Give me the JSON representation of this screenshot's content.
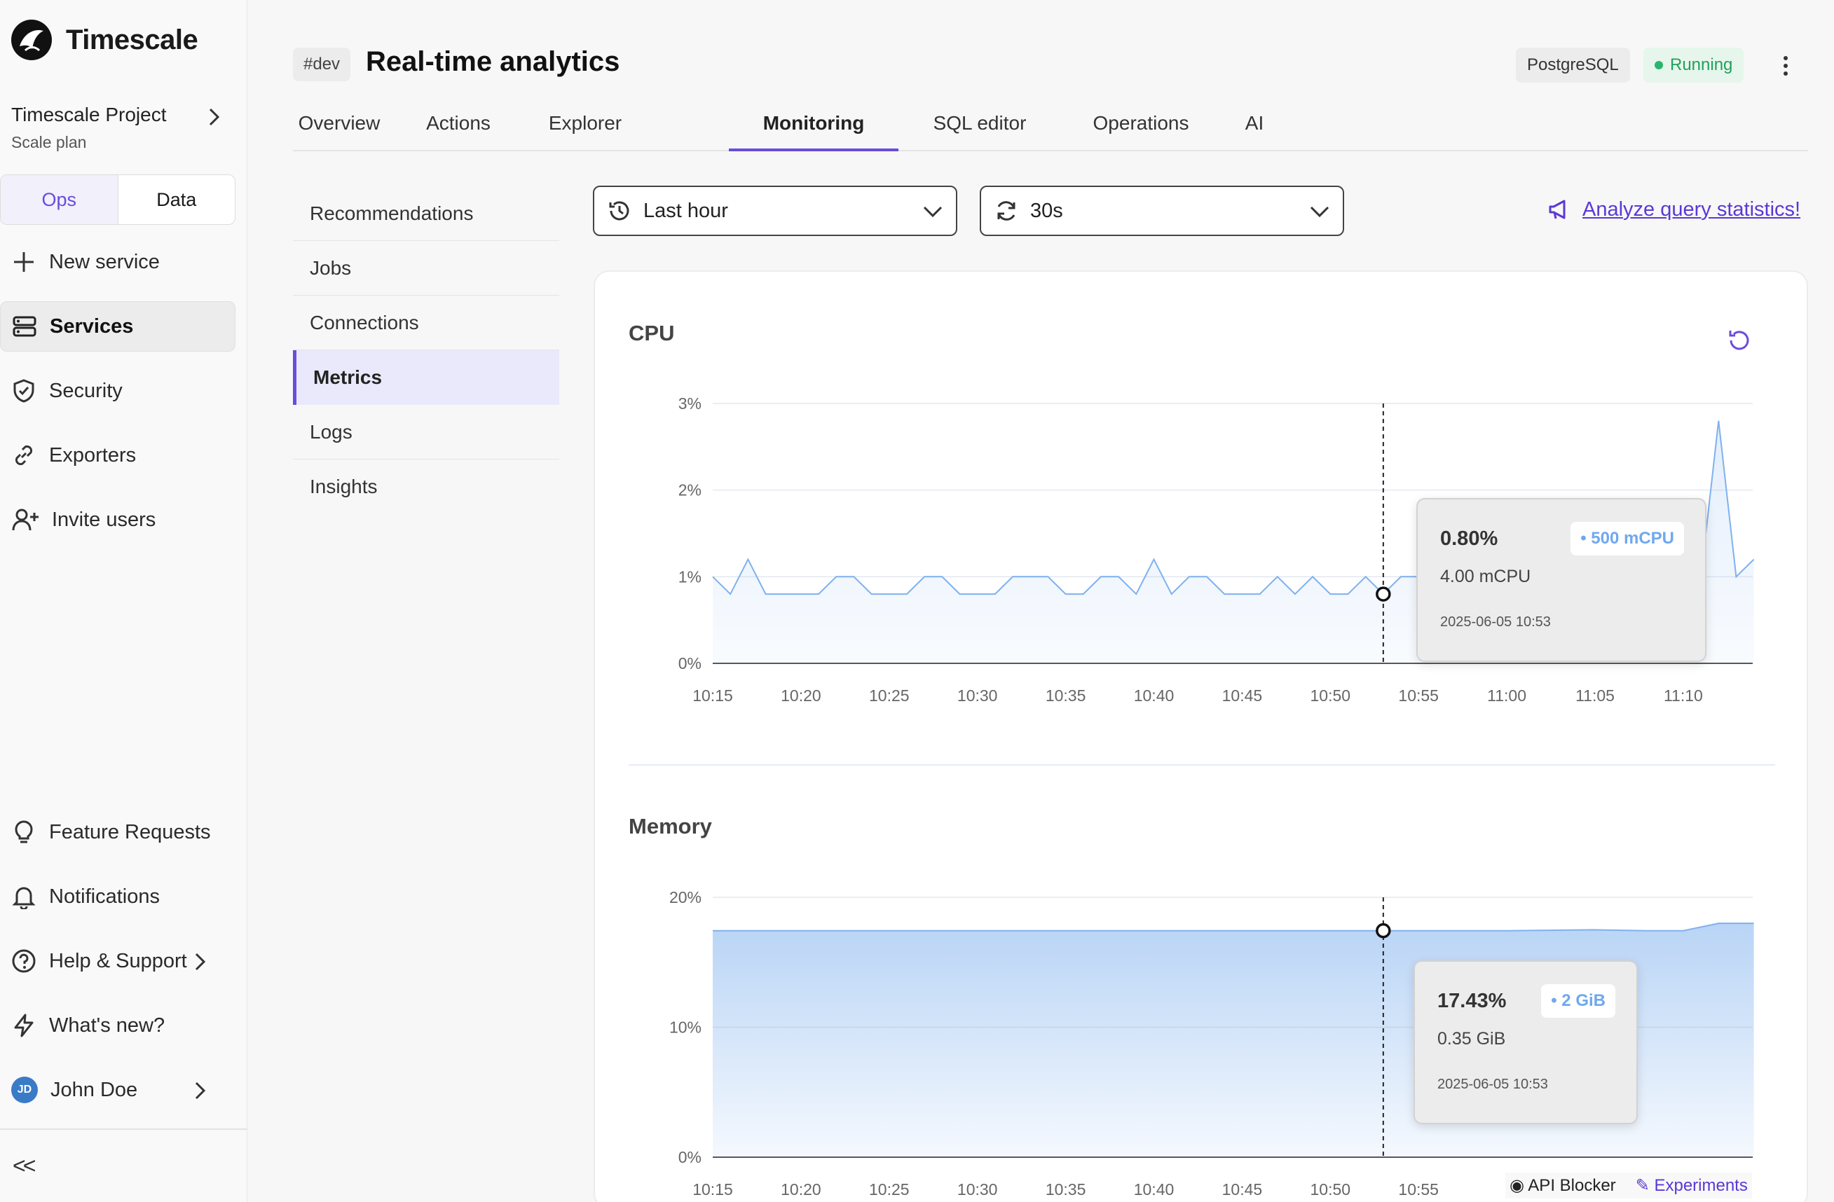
{
  "app": {
    "name": "Timescale"
  },
  "sidebar": {
    "project_name": "Timescale Project",
    "project_plan": "Scale plan",
    "toggle": {
      "ops": "Ops",
      "data": "Data"
    },
    "items": [
      {
        "label": "New service",
        "icon": "plus-icon"
      },
      {
        "label": "Services",
        "icon": "server-icon",
        "active": true
      },
      {
        "label": "Security",
        "icon": "shield-icon"
      },
      {
        "label": "Exporters",
        "icon": "link-icon"
      },
      {
        "label": "Invite users",
        "icon": "user-plus-icon"
      }
    ],
    "bottom_items": [
      {
        "label": "Feature Requests",
        "icon": "lightbulb-icon"
      },
      {
        "label": "Notifications",
        "icon": "bell-icon"
      },
      {
        "label": "Help & Support",
        "icon": "help-icon"
      },
      {
        "label": "What's new?",
        "icon": "lightning-icon"
      }
    ],
    "user": {
      "name": "John Doe",
      "initials": "JD"
    },
    "collapse_label": "<<"
  },
  "header": {
    "env_badge": "#dev",
    "title": "Real-time analytics",
    "db_badge": "PostgreSQL",
    "status": "Running",
    "status_color": "#22a05a"
  },
  "tabs": [
    "Overview",
    "Actions",
    "Explorer",
    "Monitoring",
    "SQL editor",
    "Operations",
    "AI"
  ],
  "active_tab": "Monitoring",
  "subnav": [
    "Recommendations",
    "Jobs",
    "Connections",
    "Metrics",
    "Logs",
    "Insights"
  ],
  "active_subnav": "Metrics",
  "filters": {
    "time_range": "Last hour",
    "refresh_interval": "30s",
    "analyze_link": "Analyze query statistics!"
  },
  "accent_color": "#6a4bdb",
  "chart_data": [
    {
      "type": "area",
      "title": "CPU",
      "x": [
        "10:15",
        "10:16",
        "10:17",
        "10:18",
        "10:19",
        "10:20",
        "10:21",
        "10:22",
        "10:23",
        "10:24",
        "10:25",
        "10:26",
        "10:27",
        "10:28",
        "10:29",
        "10:30",
        "10:31",
        "10:32",
        "10:33",
        "10:34",
        "10:35",
        "10:36",
        "10:37",
        "10:38",
        "10:39",
        "10:40",
        "10:41",
        "10:42",
        "10:43",
        "10:44",
        "10:45",
        "10:46",
        "10:47",
        "10:48",
        "10:49",
        "10:50",
        "10:51",
        "10:52",
        "10:53",
        "10:54",
        "10:55",
        "10:56",
        "10:57",
        "10:58",
        "10:59",
        "11:00",
        "11:01",
        "11:02",
        "11:03",
        "11:04",
        "11:05",
        "11:06",
        "11:07",
        "11:08",
        "11:09",
        "11:10",
        "11:11",
        "11:12",
        "11:13",
        "11:14"
      ],
      "values": [
        1.0,
        0.8,
        1.2,
        0.8,
        0.8,
        0.8,
        0.8,
        1.0,
        1.0,
        0.8,
        0.8,
        0.8,
        1.0,
        1.0,
        0.8,
        0.8,
        0.8,
        1.0,
        1.0,
        1.0,
        0.8,
        0.8,
        1.0,
        1.0,
        0.8,
        1.2,
        0.8,
        1.0,
        1.0,
        0.8,
        0.8,
        0.8,
        1.0,
        0.8,
        1.0,
        0.8,
        0.8,
        1.0,
        0.8,
        1.0,
        1.0,
        1.0,
        1.0,
        1.0,
        1.0,
        1.0,
        1.0,
        1.0,
        1.0,
        1.0,
        1.0,
        1.0,
        1.0,
        1.0,
        1.0,
        1.0,
        1.0,
        2.8,
        1.0,
        1.2
      ],
      "x_ticks": [
        "10:15",
        "10:20",
        "10:25",
        "10:30",
        "10:35",
        "10:40",
        "10:45",
        "10:50",
        "10:55",
        "11:00",
        "11:05",
        "11:10"
      ],
      "y_ticks": [
        "0%",
        "1%",
        "2%",
        "3%"
      ],
      "ylim": [
        0,
        3
      ],
      "grid": true,
      "color": "#7fb1ee",
      "tooltip": {
        "value": "0.80%",
        "sub": "4.00 mCPU",
        "date": "2025-06-05 10:53",
        "badge": "• 500 mCPU",
        "x": "10:53"
      }
    },
    {
      "type": "area",
      "title": "Memory",
      "x": [
        "10:15",
        "10:30",
        "10:45",
        "11:00",
        "11:05",
        "11:08",
        "11:10",
        "11:12",
        "11:14"
      ],
      "values": [
        17.43,
        17.43,
        17.43,
        17.43,
        17.5,
        17.43,
        17.43,
        18.0,
        18.0
      ],
      "x_ticks": [
        "10:15",
        "10:20",
        "10:25",
        "10:30",
        "10:35",
        "10:40",
        "10:45",
        "10:50",
        "10:55"
      ],
      "y_ticks": [
        "0%",
        "10%",
        "20%"
      ],
      "ylim": [
        0,
        20
      ],
      "grid": true,
      "color": "#7fb1ee",
      "tooltip": {
        "value": "17.43%",
        "sub": "0.35 GiB",
        "date": "2025-06-05 10:53",
        "badge": "• 2 GiB",
        "x": "10:53"
      }
    }
  ],
  "footer": {
    "api_blocker": "API Blocker",
    "experiments": "Experiments"
  }
}
